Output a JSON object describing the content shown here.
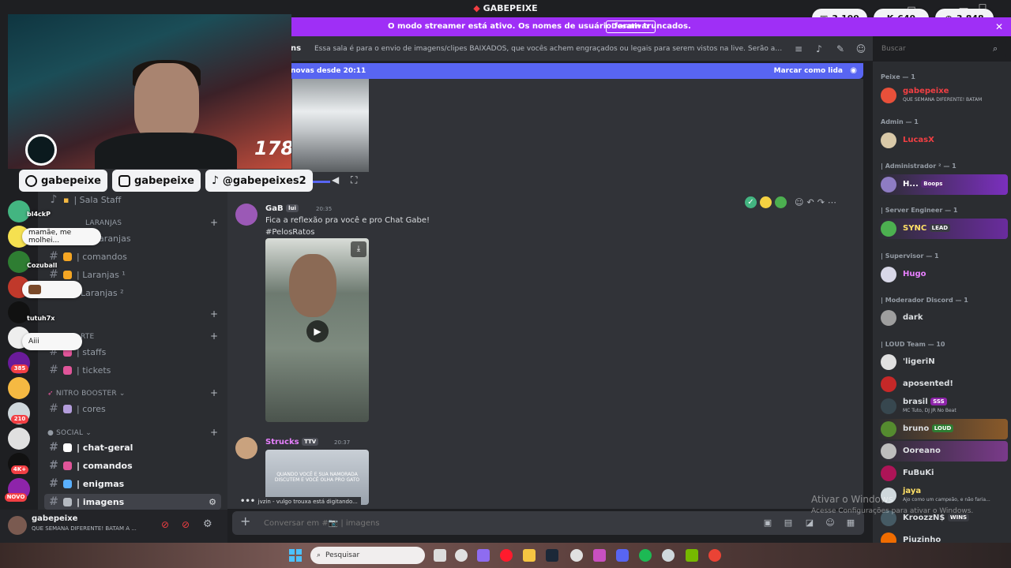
{
  "app": {
    "title": "GABEPEIXE"
  },
  "top_counters": [
    {
      "icon": "twitch-icon",
      "value": "3.199"
    },
    {
      "icon": "kick-icon",
      "value": "649"
    },
    {
      "icon": "globe-icon",
      "value": "3.848"
    }
  ],
  "streamer_mode": {
    "text": "O modo streamer está ativo. Os nomes de usuário foram truncados.",
    "button": "Desativar"
  },
  "webcam": {
    "counter": "178",
    "socials": [
      {
        "icon": "youtube-icon",
        "handle": "gabepeixe"
      },
      {
        "icon": "instagram-icon",
        "handle": "gabepeixe"
      },
      {
        "icon": "tiktok-icon",
        "handle": "@gabepeixes2"
      }
    ],
    "chat": [
      {
        "name": "bl4ckP",
        "message": ""
      },
      {
        "name": "",
        "message": "mamãe, me molhei..."
      },
      {
        "name": "Cozuball",
        "message": ""
      },
      {
        "name": "",
        "message": ""
      },
      {
        "name": "tutuh7x",
        "message": ""
      },
      {
        "name": "",
        "message": "Aiii"
      }
    ]
  },
  "guilds": {
    "badges": [
      "385",
      "210",
      "4K+",
      "NOVO"
    ]
  },
  "sidebar": {
    "channels_top": [
      {
        "name": "| Sala Staff",
        "icon": "lock-icon"
      }
    ],
    "laranjas_category": "LARANJAS",
    "laranjas_channels": [
      {
        "name": "laranjas"
      },
      {
        "name": "| comandos"
      },
      {
        "name": "| Laranjas ¹"
      },
      {
        "name": "Laranjas ²"
      }
    ],
    "suporte_category": "RTE",
    "suporte_channels": [
      {
        "name": "| staffs"
      },
      {
        "name": "| tickets"
      }
    ],
    "booster_category": "NITRO BOOSTER",
    "booster_channels": [
      {
        "name": "| cores"
      }
    ],
    "social_category": "SOCIAL",
    "social_channels": [
      {
        "name": "| chat-geral"
      },
      {
        "name": "| comandos"
      },
      {
        "name": "| enigmas"
      },
      {
        "name": "| imagens"
      }
    ]
  },
  "user_panel": {
    "name": "gabepeixe",
    "status": "QUE SEMANA DIFERENTE! BATAM A ..."
  },
  "channel_header": {
    "name": "ns",
    "topic": "Essa sala é para o envio de imagens/clipes BAIXADOS, que vocês achem engraçados ou legais para serem vistos na live. Serão apagados prints de o...",
    "search_placeholder": "Buscar"
  },
  "new_bar": {
    "left": "novas desde 20:11",
    "right": "Marcar como lida"
  },
  "messages": [
    {
      "author": "GaB",
      "tag": "lui",
      "time": "20:35",
      "lines": [
        "Fica a reflexão pra você e pro Chat Gabe!",
        "#PelosRatos"
      ]
    },
    {
      "author": "Strucks",
      "tag": "TTV",
      "time": "20:37",
      "video_caption": "QUANDO VOCÊ E SUA NAMORADA DISCUTEM E VOCÊ OLHA PRO GATO"
    }
  ],
  "typing": "jvzin - vulgo trouxa está digitando...",
  "composer": {
    "placeholder": "Conversar em #📷 | imagens"
  },
  "members": {
    "groups": [
      {
        "header": "Peixe — 1",
        "members": [
          {
            "name": "gabepeixe",
            "sub": "QUE SEMANA DIFERENTE! BATAM",
            "color": "#f23f43"
          }
        ]
      },
      {
        "header": "Admin — 1",
        "members": [
          {
            "name": "LucasX",
            "sub": "",
            "color": "#f23f43"
          }
        ]
      },
      {
        "header": "| Administrador ² — 1",
        "members": [
          {
            "name": "H...",
            "sub": "",
            "badge": "Boops",
            "color": "#ffffff"
          }
        ]
      },
      {
        "header": "| Server Engineer — 1",
        "members": [
          {
            "name": "SYNC",
            "sub": "",
            "badge": "LEAD",
            "color": "#ffe066"
          }
        ]
      },
      {
        "header": "| Supervisor — 1",
        "members": [
          {
            "name": "Hugo",
            "sub": "",
            "color": "#e880ff"
          }
        ]
      },
      {
        "header": "| Moderador Discord — 1",
        "members": [
          {
            "name": "dark",
            "sub": "",
            "color": "#dbdee1"
          }
        ]
      },
      {
        "header": "| LOUD Team — 10",
        "members": [
          {
            "name": "'ligeriN",
            "sub": "",
            "color": "#dbdee1"
          },
          {
            "name": "aposented!",
            "sub": "",
            "color": "#dbdee1"
          },
          {
            "name": "brasil",
            "sub": "MC Tuto, DJ JR No Beat",
            "badge": "SSS",
            "color": "#dbdee1"
          },
          {
            "name": "bruno",
            "sub": "",
            "badge": "LOUD",
            "color": "#dbdee1"
          },
          {
            "name": "Ooreano",
            "sub": "",
            "color": "#dbdee1"
          },
          {
            "name": "FuBuKi",
            "sub": "",
            "color": "#dbdee1"
          },
          {
            "name": "jaya",
            "sub": "Ajo como um campeão, e não faria...",
            "color": "#ffe066"
          },
          {
            "name": "KroozzN$",
            "sub": "",
            "badge": "WINS",
            "color": "#dbdee1"
          },
          {
            "name": "Piuzinho",
            "sub": "",
            "color": "#dbdee1"
          }
        ]
      }
    ]
  },
  "windows_activation": {
    "title": "Ativar o Windows",
    "subtitle": "Acesse Configurações para ativar o Windows."
  },
  "taskbar": {
    "search_placeholder": "Pesquisar"
  },
  "colors": {
    "accent": "#5865f2",
    "streamer": "#9f2ff6",
    "background": "#313338"
  }
}
